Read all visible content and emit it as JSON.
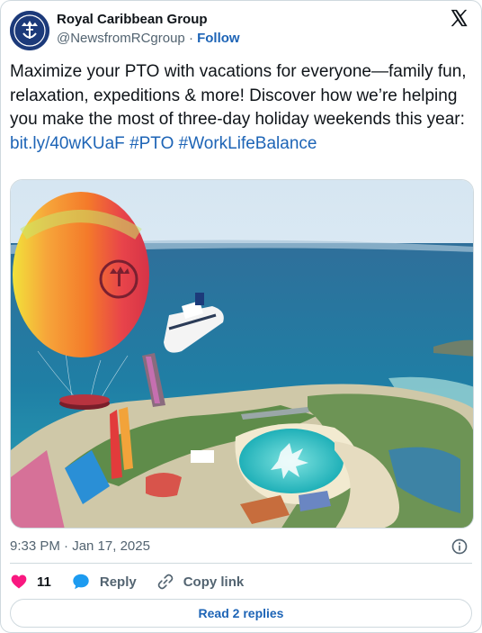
{
  "author": {
    "name": "Royal Caribbean Group",
    "handle": "@NewsfromRCgroup",
    "separator": "·",
    "follow_label": "Follow"
  },
  "tweet": {
    "text": "Maximize your PTO with vacations for everyone—family fun, relaxation, expeditions & more! Discover how we’re helping you make the most of three-day holiday weekends this year: ",
    "link": "bit.ly/40wKUaF",
    "hashtag_1": "#PTO",
    "hashtag_2": "#WorkLifeBalance"
  },
  "media": {
    "icon": "photo-aerial-private-island-balloon-cruise-ship"
  },
  "meta": {
    "timestamp": "9:33 PM · Jan 17, 2025"
  },
  "actions": {
    "likes_count": "11",
    "reply_label": "Reply",
    "copy_link_label": "Copy link"
  },
  "footer": {
    "read_replies_label": "Read 2 replies"
  },
  "colors": {
    "accent": "#1d64b6",
    "like": "#f91880",
    "reply": "#1d9bf0",
    "muted": "#536471",
    "border": "#cfd9de"
  }
}
